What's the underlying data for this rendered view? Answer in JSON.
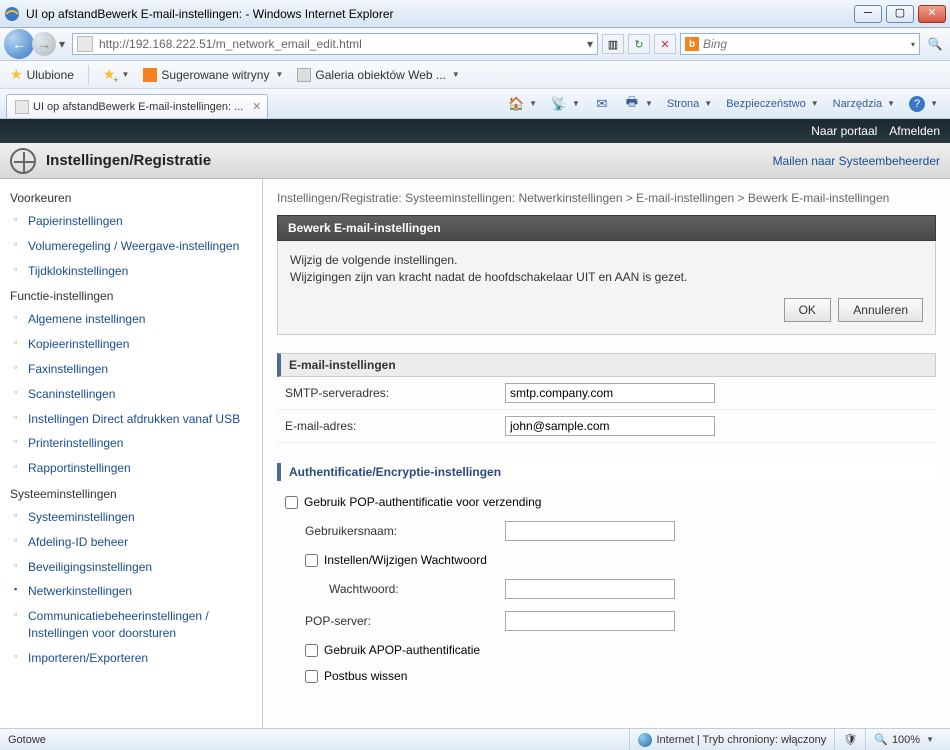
{
  "window": {
    "title": "UI op afstandBewerk E-mail-instellingen:                                         - Windows Internet Explorer"
  },
  "nav": {
    "url": "http://192.168.222.51/m_network_email_edit.html",
    "search_placeholder": "Bing"
  },
  "favorites": {
    "label": "Ulubione",
    "suggested": "Sugerowane witryny",
    "gallery": "Galeria obiektów Web ..."
  },
  "tab": {
    "title": "UI op afstandBewerk E-mail-instellingen:            ..."
  },
  "commands": {
    "page": "Strona",
    "safety": "Bezpieczeństwo",
    "tools": "Narzędzia"
  },
  "device": {
    "portal": "Naar portaal",
    "logout": "Afmelden",
    "title": "Instellingen/Registratie",
    "mail_admin": "Mailen naar Systeembeheerder"
  },
  "sidebar": {
    "cat1": "Voorkeuren",
    "items1": [
      "Papierinstellingen",
      "Volumeregeling / Weergave-instellingen",
      "Tijdklokinstellingen"
    ],
    "cat2": "Functie-instellingen",
    "items2": [
      "Algemene instellingen",
      "Kopieerinstellingen",
      "Faxinstellingen",
      "Scaninstellingen",
      "Instellingen Direct afdrukken vanaf USB",
      "Printerinstellingen",
      "Rapportinstellingen"
    ],
    "cat3": "Systeeminstellingen",
    "items3": [
      "Systeeminstellingen",
      "Afdeling-ID beheer",
      "Beveiligingsinstellingen",
      "Netwerkinstellingen",
      "Communicatiebeheerinstellingen / Instellingen voor doorsturen",
      "Importeren/Exporteren"
    ]
  },
  "main": {
    "breadcrumb": "Instellingen/Registratie: Systeeminstellingen: Netwerkinstellingen > E-mail-instellingen > Bewerk E-mail-instellingen",
    "panel_title": "Bewerk E-mail-instellingen",
    "msg1": "Wijzig de volgende instellingen.",
    "msg2": "Wijzigingen zijn van kracht nadat de hoofdschakelaar UIT en AAN is gezet.",
    "ok": "OK",
    "cancel": "Annuleren",
    "section_email": "E-mail-instellingen",
    "smtp_label": "SMTP-serveradres:",
    "smtp_value": "smtp.company.com",
    "email_label": "E-mail-adres:",
    "email_value": "john@sample.com",
    "section_auth": "Authentificatie/Encryptie-instellingen",
    "pop_auth": "Gebruik POP-authentificatie voor verzending",
    "username_label": "Gebruikersnaam:",
    "setpw": "Instellen/Wijzigen Wachtwoord",
    "pw_label": "Wachtwoord:",
    "popserver_label": "POP-server:",
    "apop": "Gebruik APOP-authentificatie",
    "clearbox": "Postbus wissen"
  },
  "status": {
    "ready": "Gotowe",
    "zone": "Internet | Tryb chroniony: włączony",
    "zoom": "100%"
  }
}
